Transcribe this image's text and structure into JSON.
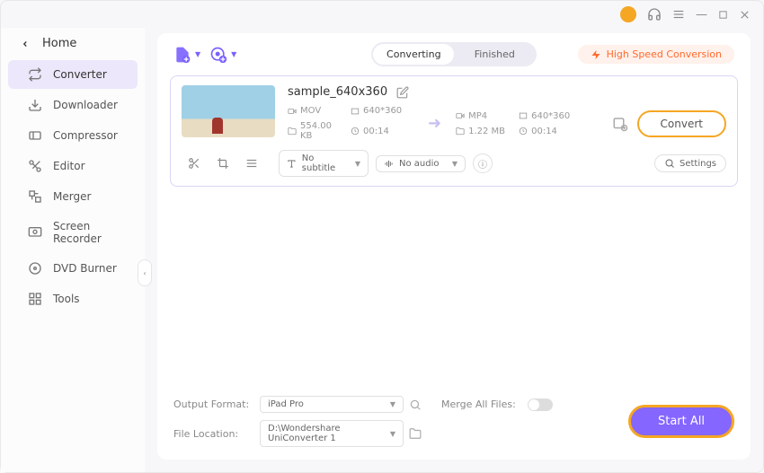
{
  "home_label": "Home",
  "sidebar": [
    {
      "label": "Converter",
      "active": true
    },
    {
      "label": "Downloader",
      "active": false
    },
    {
      "label": "Compressor",
      "active": false
    },
    {
      "label": "Editor",
      "active": false
    },
    {
      "label": "Merger",
      "active": false
    },
    {
      "label": "Screen Recorder",
      "active": false
    },
    {
      "label": "DVD Burner",
      "active": false
    },
    {
      "label": "Tools",
      "active": false
    }
  ],
  "tabs": {
    "converting": "Converting",
    "finished": "Finished"
  },
  "high_speed": "High Speed Conversion",
  "file": {
    "name": "sample_640x360",
    "src": {
      "format": "MOV",
      "res": "640*360",
      "size": "554.00 KB",
      "dur": "00:14"
    },
    "dst": {
      "format": "MP4",
      "res": "640*360",
      "size": "1.22 MB",
      "dur": "00:14"
    },
    "subtitle": "No subtitle",
    "audio": "No audio",
    "settings": "Settings",
    "convert": "Convert"
  },
  "bottom": {
    "out_fmt_label": "Output Format:",
    "out_fmt_value": "iPad Pro",
    "loc_label": "File Location:",
    "loc_value": "D:\\Wondershare UniConverter 1",
    "merge_label": "Merge All Files:",
    "start_all": "Start All"
  }
}
